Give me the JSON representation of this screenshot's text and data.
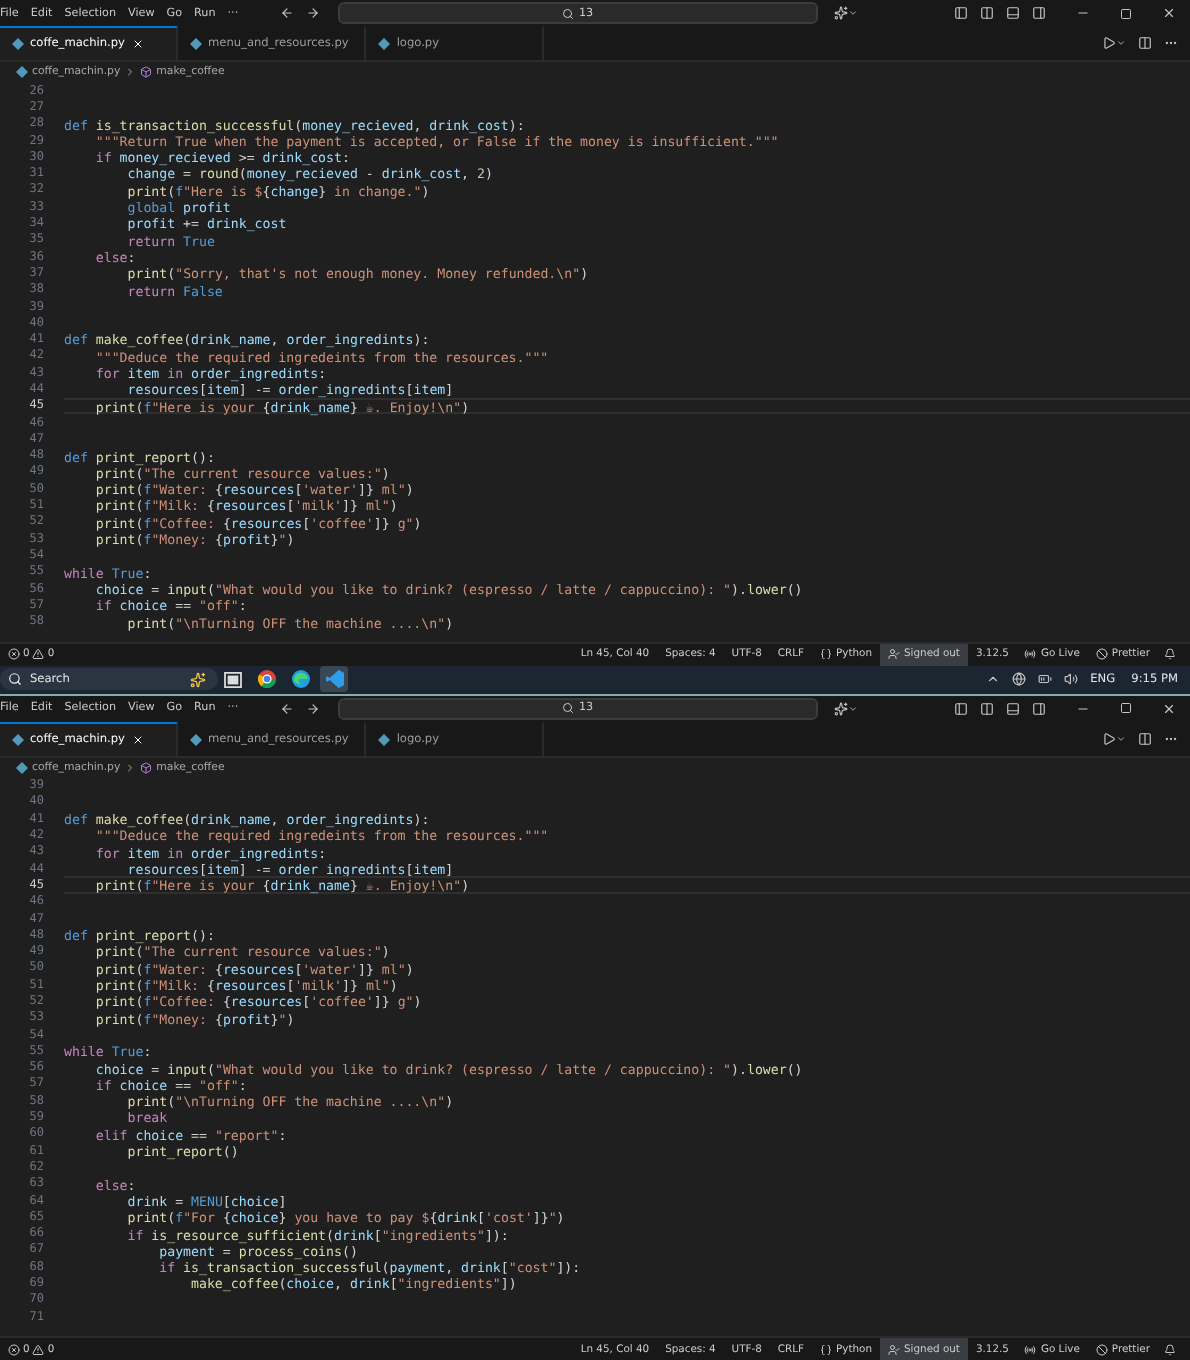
{
  "windows": [
    {
      "menu": [
        "File",
        "Edit",
        "Selection",
        "View",
        "Go",
        "Run",
        "···"
      ],
      "search": "13",
      "tabs": [
        {
          "label": "coffe_machin.py",
          "selected": true
        },
        {
          "label": "menu_and_resources.py",
          "selected": false
        },
        {
          "label": "logo.py",
          "selected": false
        }
      ],
      "breadcrumb": {
        "file": "coffe_machin.py",
        "symbol": "make_coffee"
      },
      "lines": [
        {
          "number": "26",
          "current": false
        },
        {
          "number": "27",
          "current": false
        },
        {
          "number": "28",
          "current": false,
          "tokens": [
            {
              "kind": "kw",
              "text": "def "
            },
            {
              "kind": "fn",
              "text": "is_transaction_successful"
            },
            {
              "kind": "pl",
              "text": "("
            },
            {
              "kind": "var",
              "text": "money_recieved"
            },
            {
              "kind": "pl",
              "text": ", "
            },
            {
              "kind": "var",
              "text": "drink_cost"
            },
            {
              "kind": "pl",
              "text": "):"
            }
          ]
        },
        {
          "number": "29",
          "current": false,
          "tokens": [
            {
              "kind": "str",
              "text": "    \"\"\"Return True when the payment is accepted, or False if the money is insufficient.\"\"\""
            }
          ]
        },
        {
          "number": "30",
          "current": false,
          "tokens": [
            {
              "kind": "ctl",
              "text": "    if "
            },
            {
              "kind": "var",
              "text": "money_recieved"
            },
            {
              "kind": "pl",
              "text": " >= "
            },
            {
              "kind": "var",
              "text": "drink_cost"
            },
            {
              "kind": "pl",
              "text": ":"
            }
          ]
        },
        {
          "number": "31",
          "current": false,
          "tokens": [
            {
              "kind": "var",
              "text": "        change"
            },
            {
              "kind": "pl",
              "text": " = "
            },
            {
              "kind": "fn",
              "text": "round"
            },
            {
              "kind": "pl",
              "text": "("
            },
            {
              "kind": "var",
              "text": "money_recieved"
            },
            {
              "kind": "pl",
              "text": " - "
            },
            {
              "kind": "var",
              "text": "drink_cost"
            },
            {
              "kind": "pl",
              "text": ", "
            },
            {
              "kind": "num",
              "text": "2"
            },
            {
              "kind": "pl",
              "text": ")"
            }
          ]
        },
        {
          "number": "32",
          "current": false,
          "tokens": [
            {
              "kind": "fn",
              "text": "        print"
            },
            {
              "kind": "pl",
              "text": "("
            },
            {
              "kind": "const",
              "text": "f"
            },
            {
              "kind": "str",
              "text": "\"Here is $"
            },
            {
              "kind": "pl",
              "text": "{"
            },
            {
              "kind": "var",
              "text": "change"
            },
            {
              "kind": "pl",
              "text": "}"
            },
            {
              "kind": "str",
              "text": " in change.\""
            },
            {
              "kind": "pl",
              "text": ")"
            }
          ]
        },
        {
          "number": "33",
          "current": false,
          "tokens": [
            {
              "kind": "kw",
              "text": "        global "
            },
            {
              "kind": "var",
              "text": "profit"
            }
          ]
        },
        {
          "number": "34",
          "current": false,
          "tokens": [
            {
              "kind": "var",
              "text": "        profit"
            },
            {
              "kind": "pl",
              "text": " += "
            },
            {
              "kind": "var",
              "text": "drink_cost"
            }
          ]
        },
        {
          "number": "35",
          "current": false,
          "tokens": [
            {
              "kind": "ctl",
              "text": "        return "
            },
            {
              "kind": "const",
              "text": "True"
            }
          ]
        },
        {
          "number": "36",
          "current": false,
          "tokens": [
            {
              "kind": "ctl",
              "text": "    else"
            },
            {
              "kind": "pl",
              "text": ":"
            }
          ]
        },
        {
          "number": "37",
          "current": false,
          "tokens": [
            {
              "kind": "fn",
              "text": "        print"
            },
            {
              "kind": "pl",
              "text": "("
            },
            {
              "kind": "str",
              "text": "\"Sorry, that's not enough money. Money refunded.\\n\""
            },
            {
              "kind": "pl",
              "text": ")"
            }
          ]
        },
        {
          "number": "38",
          "current": false,
          "tokens": [
            {
              "kind": "ctl",
              "text": "        return "
            },
            {
              "kind": "const",
              "text": "False"
            }
          ]
        },
        {
          "number": "39",
          "current": false
        },
        {
          "number": "40",
          "current": false
        },
        {
          "number": "41",
          "current": false,
          "tokens": [
            {
              "kind": "kw",
              "text": "def "
            },
            {
              "kind": "fn",
              "text": "make_coffee"
            },
            {
              "kind": "pl",
              "text": "("
            },
            {
              "kind": "var",
              "text": "drink_name"
            },
            {
              "kind": "pl",
              "text": ", "
            },
            {
              "kind": "var",
              "text": "order_ingredints"
            },
            {
              "kind": "pl",
              "text": "):"
            }
          ]
        },
        {
          "number": "42",
          "current": false,
          "tokens": [
            {
              "kind": "str",
              "text": "    \"\"\"Deduce the required ingredeints from the resources.\"\"\""
            }
          ]
        },
        {
          "number": "43",
          "current": false,
          "tokens": [
            {
              "kind": "ctl",
              "text": "    for "
            },
            {
              "kind": "var",
              "text": "item"
            },
            {
              "kind": "ctl",
              "text": " in "
            },
            {
              "kind": "var",
              "text": "order_ingredints"
            },
            {
              "kind": "pl",
              "text": ":"
            }
          ]
        },
        {
          "number": "44",
          "current": false,
          "tokens": [
            {
              "kind": "var",
              "text": "        resources"
            },
            {
              "kind": "pl",
              "text": "["
            },
            {
              "kind": "var",
              "text": "item"
            },
            {
              "kind": "pl",
              "text": "] -= "
            },
            {
              "kind": "var",
              "text": "order_ingredints"
            },
            {
              "kind": "pl",
              "text": "["
            },
            {
              "kind": "var",
              "text": "item"
            },
            {
              "kind": "pl",
              "text": "]"
            }
          ]
        },
        {
          "number": "45",
          "current": true,
          "tokens": [
            {
              "kind": "fn",
              "text": "    print"
            },
            {
              "kind": "pl",
              "text": "("
            },
            {
              "kind": "const",
              "text": "f"
            },
            {
              "kind": "str",
              "text": "\"Here is your "
            },
            {
              "kind": "pl",
              "text": "{"
            },
            {
              "kind": "var",
              "text": "drink_name"
            },
            {
              "kind": "pl",
              "text": "} "
            },
            {
              "kind": "str",
              "text": "☕. Enjoy!\\n\""
            },
            {
              "kind": "pl",
              "text": ")"
            }
          ]
        },
        {
          "number": "46",
          "current": false
        },
        {
          "number": "47",
          "current": false
        },
        {
          "number": "48",
          "current": false,
          "tokens": [
            {
              "kind": "kw",
              "text": "def "
            },
            {
              "kind": "fn",
              "text": "print_report"
            },
            {
              "kind": "pl",
              "text": "():"
            }
          ]
        },
        {
          "number": "49",
          "current": false,
          "tokens": [
            {
              "kind": "fn",
              "text": "    print"
            },
            {
              "kind": "pl",
              "text": "("
            },
            {
              "kind": "str",
              "text": "\"The current resource values:\""
            },
            {
              "kind": "pl",
              "text": ")"
            }
          ]
        },
        {
          "number": "50",
          "current": false,
          "tokens": [
            {
              "kind": "fn",
              "text": "    print"
            },
            {
              "kind": "pl",
              "text": "("
            },
            {
              "kind": "const",
              "text": "f"
            },
            {
              "kind": "str",
              "text": "\"Water: "
            },
            {
              "kind": "pl",
              "text": "{"
            },
            {
              "kind": "var",
              "text": "resources"
            },
            {
              "kind": "pl",
              "text": "["
            },
            {
              "kind": "str",
              "text": "'water'"
            },
            {
              "kind": "pl",
              "text": "]}"
            },
            {
              "kind": "str",
              "text": " ml\""
            },
            {
              "kind": "pl",
              "text": ")"
            }
          ]
        },
        {
          "number": "51",
          "current": false,
          "tokens": [
            {
              "kind": "fn",
              "text": "    print"
            },
            {
              "kind": "pl",
              "text": "("
            },
            {
              "kind": "const",
              "text": "f"
            },
            {
              "kind": "str",
              "text": "\"Milk: "
            },
            {
              "kind": "pl",
              "text": "{"
            },
            {
              "kind": "var",
              "text": "resources"
            },
            {
              "kind": "pl",
              "text": "["
            },
            {
              "kind": "str",
              "text": "'milk'"
            },
            {
              "kind": "pl",
              "text": "]}"
            },
            {
              "kind": "str",
              "text": " ml\""
            },
            {
              "kind": "pl",
              "text": ")"
            }
          ]
        },
        {
          "number": "52",
          "current": false,
          "tokens": [
            {
              "kind": "fn",
              "text": "    print"
            },
            {
              "kind": "pl",
              "text": "("
            },
            {
              "kind": "const",
              "text": "f"
            },
            {
              "kind": "str",
              "text": "\"Coffee: "
            },
            {
              "kind": "pl",
              "text": "{"
            },
            {
              "kind": "var",
              "text": "resources"
            },
            {
              "kind": "pl",
              "text": "["
            },
            {
              "kind": "str",
              "text": "'coffee'"
            },
            {
              "kind": "pl",
              "text": "]}"
            },
            {
              "kind": "str",
              "text": " g\""
            },
            {
              "kind": "pl",
              "text": ")"
            }
          ]
        },
        {
          "number": "53",
          "current": false,
          "tokens": [
            {
              "kind": "fn",
              "text": "    print"
            },
            {
              "kind": "pl",
              "text": "("
            },
            {
              "kind": "const",
              "text": "f"
            },
            {
              "kind": "str",
              "text": "\"Money: "
            },
            {
              "kind": "pl",
              "text": "{"
            },
            {
              "kind": "var",
              "text": "profit"
            },
            {
              "kind": "pl",
              "text": "}"
            },
            {
              "kind": "str",
              "text": "\""
            },
            {
              "kind": "pl",
              "text": ")"
            }
          ]
        },
        {
          "number": "54",
          "current": false
        },
        {
          "number": "55",
          "current": false,
          "tokens": [
            {
              "kind": "ctl",
              "text": "while "
            },
            {
              "kind": "const",
              "text": "True"
            },
            {
              "kind": "pl",
              "text": ":"
            }
          ]
        },
        {
          "number": "56",
          "current": false,
          "tokens": [
            {
              "kind": "var",
              "text": "    choice"
            },
            {
              "kind": "pl",
              "text": " = "
            },
            {
              "kind": "fn",
              "text": "input"
            },
            {
              "kind": "pl",
              "text": "("
            },
            {
              "kind": "str",
              "text": "\"What would you like to drink? (espresso / latte / cappuccino): \""
            },
            {
              "kind": "pl",
              "text": ")."
            },
            {
              "kind": "fn",
              "text": "lower"
            },
            {
              "kind": "pl",
              "text": "()"
            }
          ]
        },
        {
          "number": "57",
          "current": false,
          "tokens": [
            {
              "kind": "ctl",
              "text": "    if "
            },
            {
              "kind": "var",
              "text": "choice"
            },
            {
              "kind": "pl",
              "text": " == "
            },
            {
              "kind": "str",
              "text": "\"off\""
            },
            {
              "kind": "pl",
              "text": ":"
            }
          ]
        },
        {
          "number": "58",
          "current": false,
          "tokens": [
            {
              "kind": "fn",
              "text": "        print"
            },
            {
              "kind": "pl",
              "text": "("
            },
            {
              "kind": "str",
              "text": "\"\\nTurning OFF the machine ....\\n\""
            },
            {
              "kind": "pl",
              "text": ")"
            }
          ]
        }
      ],
      "status": {
        "errors": "0",
        "warnings": "0",
        "items": [
          {
            "kind": "text",
            "text": "Ln 45, Col 40"
          },
          {
            "kind": "text",
            "text": "Spaces: 4"
          },
          {
            "kind": "text",
            "text": "UTF-8"
          },
          {
            "kind": "text",
            "text": "CRLF"
          },
          {
            "kind": "language",
            "text": "Python"
          },
          {
            "kind": "account",
            "text": "Signed out"
          },
          {
            "kind": "text",
            "text": "3.12.5"
          },
          {
            "kind": "live",
            "text": "Go Live"
          },
          {
            "kind": "formatter",
            "text": "Prettier"
          }
        ]
      }
    },
    {
      "menu": [
        "File",
        "Edit",
        "Selection",
        "View",
        "Go",
        "Run",
        "···"
      ],
      "search": "13",
      "tabs": [
        {
          "label": "coffe_machin.py",
          "selected": true
        },
        {
          "label": "menu_and_resources.py",
          "selected": false
        },
        {
          "label": "logo.py",
          "selected": false
        }
      ],
      "breadcrumb": {
        "file": "coffe_machin.py",
        "symbol": "make_coffee"
      },
      "lines": [
        {
          "number": "39",
          "current": false
        },
        {
          "number": "40",
          "current": false
        },
        {
          "number": "41",
          "current": false,
          "tokens": [
            {
              "kind": "kw",
              "text": "def "
            },
            {
              "kind": "fn",
              "text": "make_coffee"
            },
            {
              "kind": "pl",
              "text": "("
            },
            {
              "kind": "var",
              "text": "drink_name"
            },
            {
              "kind": "pl",
              "text": ", "
            },
            {
              "kind": "var",
              "text": "order_ingredints"
            },
            {
              "kind": "pl",
              "text": "):"
            }
          ]
        },
        {
          "number": "42",
          "current": false,
          "tokens": [
            {
              "kind": "str",
              "text": "    \"\"\"Deduce the required ingredeints from the resources.\"\"\""
            }
          ]
        },
        {
          "number": "43",
          "current": false,
          "tokens": [
            {
              "kind": "ctl",
              "text": "    for "
            },
            {
              "kind": "var",
              "text": "item"
            },
            {
              "kind": "ctl",
              "text": " in "
            },
            {
              "kind": "var",
              "text": "order_ingredints"
            },
            {
              "kind": "pl",
              "text": ":"
            }
          ]
        },
        {
          "number": "44",
          "current": false,
          "tokens": [
            {
              "kind": "var",
              "text": "        resources"
            },
            {
              "kind": "pl",
              "text": "["
            },
            {
              "kind": "var",
              "text": "item"
            },
            {
              "kind": "pl",
              "text": "] -= "
            },
            {
              "kind": "var",
              "text": "order_ingredints"
            },
            {
              "kind": "pl",
              "text": "["
            },
            {
              "kind": "var",
              "text": "item"
            },
            {
              "kind": "pl",
              "text": "]"
            }
          ]
        },
        {
          "number": "45",
          "current": true,
          "tokens": [
            {
              "kind": "fn",
              "text": "    print"
            },
            {
              "kind": "pl",
              "text": "("
            },
            {
              "kind": "const",
              "text": "f"
            },
            {
              "kind": "str",
              "text": "\"Here is your "
            },
            {
              "kind": "pl",
              "text": "{"
            },
            {
              "kind": "var",
              "text": "drink_name"
            },
            {
              "kind": "pl",
              "text": "} "
            },
            {
              "kind": "str",
              "text": "☕. Enjoy!\\n\""
            },
            {
              "kind": "pl",
              "text": ")"
            }
          ]
        },
        {
          "number": "46",
          "current": false
        },
        {
          "number": "47",
          "current": false
        },
        {
          "number": "48",
          "current": false,
          "tokens": [
            {
              "kind": "kw",
              "text": "def "
            },
            {
              "kind": "fn",
              "text": "print_report"
            },
            {
              "kind": "pl",
              "text": "():"
            }
          ]
        },
        {
          "number": "49",
          "current": false,
          "tokens": [
            {
              "kind": "fn",
              "text": "    print"
            },
            {
              "kind": "pl",
              "text": "("
            },
            {
              "kind": "str",
              "text": "\"The current resource values:\""
            },
            {
              "kind": "pl",
              "text": ")"
            }
          ]
        },
        {
          "number": "50",
          "current": false,
          "tokens": [
            {
              "kind": "fn",
              "text": "    print"
            },
            {
              "kind": "pl",
              "text": "("
            },
            {
              "kind": "const",
              "text": "f"
            },
            {
              "kind": "str",
              "text": "\"Water: "
            },
            {
              "kind": "pl",
              "text": "{"
            },
            {
              "kind": "var",
              "text": "resources"
            },
            {
              "kind": "pl",
              "text": "["
            },
            {
              "kind": "str",
              "text": "'water'"
            },
            {
              "kind": "pl",
              "text": "]}"
            },
            {
              "kind": "str",
              "text": " ml\""
            },
            {
              "kind": "pl",
              "text": ")"
            }
          ]
        },
        {
          "number": "51",
          "current": false,
          "tokens": [
            {
              "kind": "fn",
              "text": "    print"
            },
            {
              "kind": "pl",
              "text": "("
            },
            {
              "kind": "const",
              "text": "f"
            },
            {
              "kind": "str",
              "text": "\"Milk: "
            },
            {
              "kind": "pl",
              "text": "{"
            },
            {
              "kind": "var",
              "text": "resources"
            },
            {
              "kind": "pl",
              "text": "["
            },
            {
              "kind": "str",
              "text": "'milk'"
            },
            {
              "kind": "pl",
              "text": "]}"
            },
            {
              "kind": "str",
              "text": " ml\""
            },
            {
              "kind": "pl",
              "text": ")"
            }
          ]
        },
        {
          "number": "52",
          "current": false,
          "tokens": [
            {
              "kind": "fn",
              "text": "    print"
            },
            {
              "kind": "pl",
              "text": "("
            },
            {
              "kind": "const",
              "text": "f"
            },
            {
              "kind": "str",
              "text": "\"Coffee: "
            },
            {
              "kind": "pl",
              "text": "{"
            },
            {
              "kind": "var",
              "text": "resources"
            },
            {
              "kind": "pl",
              "text": "["
            },
            {
              "kind": "str",
              "text": "'coffee'"
            },
            {
              "kind": "pl",
              "text": "]}"
            },
            {
              "kind": "str",
              "text": " g\""
            },
            {
              "kind": "pl",
              "text": ")"
            }
          ]
        },
        {
          "number": "53",
          "current": false,
          "tokens": [
            {
              "kind": "fn",
              "text": "    print"
            },
            {
              "kind": "pl",
              "text": "("
            },
            {
              "kind": "const",
              "text": "f"
            },
            {
              "kind": "str",
              "text": "\"Money: "
            },
            {
              "kind": "pl",
              "text": "{"
            },
            {
              "kind": "var",
              "text": "profit"
            },
            {
              "kind": "pl",
              "text": "}"
            },
            {
              "kind": "str",
              "text": "\""
            },
            {
              "kind": "pl",
              "text": ")"
            }
          ]
        },
        {
          "number": "54",
          "current": false
        },
        {
          "number": "55",
          "current": false,
          "tokens": [
            {
              "kind": "ctl",
              "text": "while "
            },
            {
              "kind": "const",
              "text": "True"
            },
            {
              "kind": "pl",
              "text": ":"
            }
          ]
        },
        {
          "number": "56",
          "current": false,
          "tokens": [
            {
              "kind": "var",
              "text": "    choice"
            },
            {
              "kind": "pl",
              "text": " = "
            },
            {
              "kind": "fn",
              "text": "input"
            },
            {
              "kind": "pl",
              "text": "("
            },
            {
              "kind": "str",
              "text": "\"What would you like to drink? (espresso / latte / cappuccino): \""
            },
            {
              "kind": "pl",
              "text": ")."
            },
            {
              "kind": "fn",
              "text": "lower"
            },
            {
              "kind": "pl",
              "text": "()"
            }
          ]
        },
        {
          "number": "57",
          "current": false,
          "tokens": [
            {
              "kind": "ctl",
              "text": "    if "
            },
            {
              "kind": "var",
              "text": "choice"
            },
            {
              "kind": "pl",
              "text": " == "
            },
            {
              "kind": "str",
              "text": "\"off\""
            },
            {
              "kind": "pl",
              "text": ":"
            }
          ]
        },
        {
          "number": "58",
          "current": false,
          "tokens": [
            {
              "kind": "fn",
              "text": "        print"
            },
            {
              "kind": "pl",
              "text": "("
            },
            {
              "kind": "str",
              "text": "\"\\nTurning OFF the machine ....\\n\""
            },
            {
              "kind": "pl",
              "text": ")"
            }
          ]
        },
        {
          "number": "59",
          "current": false,
          "tokens": [
            {
              "kind": "ctl",
              "text": "        break"
            }
          ]
        },
        {
          "number": "60",
          "current": false,
          "tokens": [
            {
              "kind": "ctl",
              "text": "    elif "
            },
            {
              "kind": "var",
              "text": "choice"
            },
            {
              "kind": "pl",
              "text": " == "
            },
            {
              "kind": "str",
              "text": "\"report\""
            },
            {
              "kind": "pl",
              "text": ":"
            }
          ]
        },
        {
          "number": "61",
          "current": false,
          "tokens": [
            {
              "kind": "fn",
              "text": "        print_report"
            },
            {
              "kind": "pl",
              "text": "()"
            }
          ]
        },
        {
          "number": "62",
          "current": false
        },
        {
          "number": "63",
          "current": false,
          "tokens": [
            {
              "kind": "ctl",
              "text": "    else"
            },
            {
              "kind": "pl",
              "text": ":"
            }
          ]
        },
        {
          "number": "64",
          "current": false,
          "tokens": [
            {
              "kind": "var",
              "text": "        drink"
            },
            {
              "kind": "pl",
              "text": " = "
            },
            {
              "kind": "const",
              "text": "MENU"
            },
            {
              "kind": "pl",
              "text": "["
            },
            {
              "kind": "var",
              "text": "choice"
            },
            {
              "kind": "pl",
              "text": "]"
            }
          ]
        },
        {
          "number": "65",
          "current": false,
          "tokens": [
            {
              "kind": "fn",
              "text": "        print"
            },
            {
              "kind": "pl",
              "text": "("
            },
            {
              "kind": "const",
              "text": "f"
            },
            {
              "kind": "str",
              "text": "\"For "
            },
            {
              "kind": "pl",
              "text": "{"
            },
            {
              "kind": "var",
              "text": "choice"
            },
            {
              "kind": "pl",
              "text": "}"
            },
            {
              "kind": "str",
              "text": " you have to pay $"
            },
            {
              "kind": "pl",
              "text": "{"
            },
            {
              "kind": "var",
              "text": "drink"
            },
            {
              "kind": "pl",
              "text": "["
            },
            {
              "kind": "str",
              "text": "'cost'"
            },
            {
              "kind": "pl",
              "text": "]}"
            },
            {
              "kind": "str",
              "text": "\""
            },
            {
              "kind": "pl",
              "text": ")"
            }
          ]
        },
        {
          "number": "66",
          "current": false,
          "tokens": [
            {
              "kind": "ctl",
              "text": "        if "
            },
            {
              "kind": "fn",
              "text": "is_resource_sufficient"
            },
            {
              "kind": "pl",
              "text": "("
            },
            {
              "kind": "var",
              "text": "drink"
            },
            {
              "kind": "pl",
              "text": "["
            },
            {
              "kind": "str",
              "text": "\"ingredients\""
            },
            {
              "kind": "pl",
              "text": "]):"
            }
          ]
        },
        {
          "number": "67",
          "current": false,
          "tokens": [
            {
              "kind": "var",
              "text": "            payment"
            },
            {
              "kind": "pl",
              "text": " = "
            },
            {
              "kind": "fn",
              "text": "process_coins"
            },
            {
              "kind": "pl",
              "text": "()"
            }
          ]
        },
        {
          "number": "68",
          "current": false,
          "tokens": [
            {
              "kind": "ctl",
              "text": "            if "
            },
            {
              "kind": "fn",
              "text": "is_transaction_successful"
            },
            {
              "kind": "pl",
              "text": "("
            },
            {
              "kind": "var",
              "text": "payment"
            },
            {
              "kind": "pl",
              "text": ", "
            },
            {
              "kind": "var",
              "text": "drink"
            },
            {
              "kind": "pl",
              "text": "["
            },
            {
              "kind": "str",
              "text": "\"cost\""
            },
            {
              "kind": "pl",
              "text": "]):"
            }
          ]
        },
        {
          "number": "69",
          "current": false,
          "tokens": [
            {
              "kind": "fn",
              "text": "                make_coffee"
            },
            {
              "kind": "pl",
              "text": "("
            },
            {
              "kind": "var",
              "text": "choice"
            },
            {
              "kind": "pl",
              "text": ", "
            },
            {
              "kind": "var",
              "text": "drink"
            },
            {
              "kind": "pl",
              "text": "["
            },
            {
              "kind": "str",
              "text": "\"ingredients\""
            },
            {
              "kind": "pl",
              "text": "])"
            }
          ]
        },
        {
          "number": "70",
          "current": false
        },
        {
          "number": "71",
          "current": false
        }
      ],
      "status": {
        "errors": "0",
        "warnings": "0",
        "items": [
          {
            "kind": "text",
            "text": "Ln 45, Col 40"
          },
          {
            "kind": "text",
            "text": "Spaces: 4"
          },
          {
            "kind": "text",
            "text": "UTF-8"
          },
          {
            "kind": "text",
            "text": "CRLF"
          },
          {
            "kind": "language",
            "text": "Python"
          },
          {
            "kind": "account",
            "text": "Signed out"
          },
          {
            "kind": "text",
            "text": "3.12.5"
          },
          {
            "kind": "live",
            "text": "Go Live"
          },
          {
            "kind": "formatter",
            "text": "Prettier"
          }
        ]
      }
    }
  ],
  "taskbar": {
    "search": "Search",
    "apps": [
      {
        "kind": "task-view",
        "selected": false
      },
      {
        "kind": "browser",
        "selected": false
      },
      {
        "kind": "browser-alt",
        "selected": false
      },
      {
        "kind": "editor",
        "selected": true
      }
    ],
    "language": "ENG",
    "time": "9:15 PM"
  }
}
